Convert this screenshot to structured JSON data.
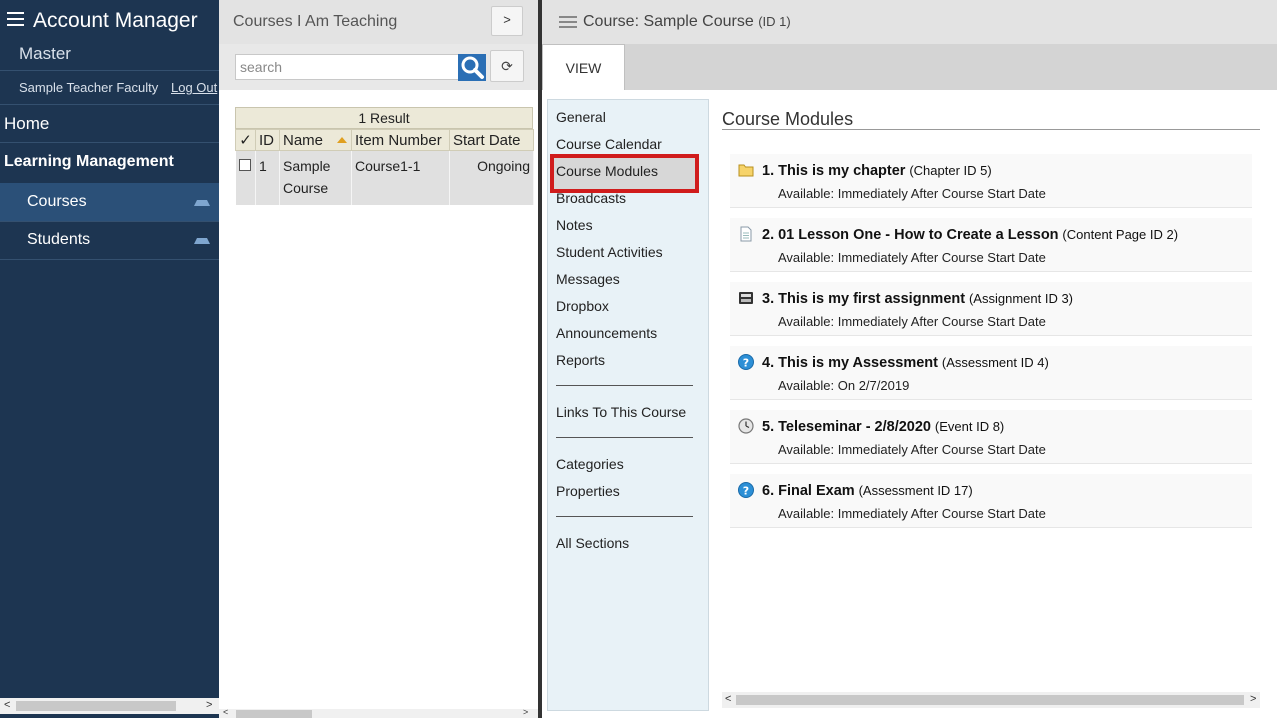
{
  "sidebar": {
    "app_title": "Account Manager",
    "org": "Master",
    "user": "Sample Teacher Faculty",
    "logout": "Log Out",
    "home": "Home",
    "learning_management": "Learning Management",
    "courses": "Courses",
    "students": "Students",
    "scroll_left": "<",
    "scroll_right": ">"
  },
  "middle": {
    "title": "Courses I Am Teaching",
    "expand": ">",
    "search_placeholder": "search",
    "refresh": "⟳",
    "result_count": "1 Result",
    "columns": [
      "✓",
      "ID",
      "Name",
      "Item Number",
      "Start Date"
    ],
    "rows": [
      {
        "id": "1",
        "name": "Sample Course",
        "item_number": "Course1-1",
        "start_date": "Ongoing"
      }
    ],
    "scroll_left": "<",
    "scroll_right": ">"
  },
  "right": {
    "title": "Course: Sample Course",
    "title_id": "(ID 1)",
    "tab_view": "VIEW",
    "nav": {
      "general": "General",
      "course_calendar": "Course Calendar",
      "course_modules": "Course Modules",
      "broadcasts": "Broadcasts",
      "notes": "Notes",
      "student_activities": "Student Activities",
      "messages": "Messages",
      "dropbox": "Dropbox",
      "announcements": "Announcements",
      "reports": "Reports",
      "links": "Links To This Course",
      "categories": "Categories",
      "properties": "Properties",
      "all_sections": "All Sections"
    },
    "content_title": "Course Modules",
    "modules": [
      {
        "title": "1. This is my chapter",
        "meta": "(Chapter ID 5)",
        "avail": "Available: Immediately After Course Start Date",
        "icon": "folder-icon"
      },
      {
        "title": "2. 01 Lesson One - How to Create a Lesson",
        "meta": "(Content Page ID 2)",
        "avail": "Available: Immediately After Course Start Date",
        "icon": "page-icon"
      },
      {
        "title": "3. This is my first assignment",
        "meta": "(Assignment ID 3)",
        "avail": "Available: Immediately After Course Start Date",
        "icon": "assignment-icon"
      },
      {
        "title": "4. This is my Assessment",
        "meta": "(Assessment ID 4)",
        "avail": "Available: On 2/7/2019",
        "icon": "question-icon"
      },
      {
        "title": "5. Teleseminar - 2/8/2020",
        "meta": "(Event ID 8)",
        "avail": "Available: Immediately After Course Start Date",
        "icon": "clock-icon"
      },
      {
        "title": "6. Final Exam",
        "meta": "(Assessment ID 17)",
        "avail": "Available: Immediately After Course Start Date",
        "icon": "question-icon"
      }
    ],
    "scroll_left": "<",
    "scroll_right": ">"
  },
  "colors": {
    "sidebar_bg": "#1d3551",
    "sidebar_active": "#2b5078",
    "selection_outline": "#d01c1c",
    "search_button": "#2b6fb5"
  }
}
